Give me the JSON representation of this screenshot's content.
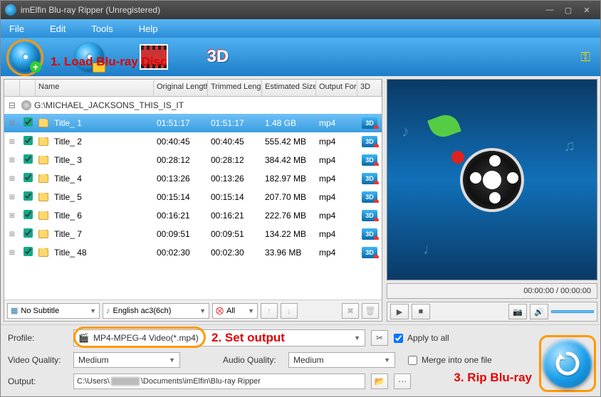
{
  "window": {
    "title": "imElfin Blu-ray Ripper (Unregistered)"
  },
  "menu": {
    "file": "File",
    "edit": "Edit",
    "tools": "Tools",
    "help": "Help"
  },
  "toolbar": {
    "load": "Load Blu-ray",
    "loadfolder": "Load Folder",
    "edit": "Edit",
    "threed": "3D"
  },
  "annotations": {
    "step1": "1. Load Blu-ray Disc",
    "step2": "2. Set output",
    "step3": "3. Rip Blu-ray"
  },
  "columns": {
    "name": "Name",
    "len": "Original Length",
    "trim": "Trimmed Length",
    "size": "Estimated Size",
    "fmt": "Output Format",
    "threeD": "3D"
  },
  "source": {
    "path": "G:\\MICHAEL_JACKSONS_THIS_IS_IT"
  },
  "rows": [
    {
      "name": "Title_ 1",
      "len": "01:51:17",
      "trim": "01:51:17",
      "size": "1.48 GB",
      "fmt": "mp4",
      "sel": true
    },
    {
      "name": "Title_ 2",
      "len": "00:40:45",
      "trim": "00:40:45",
      "size": "555.42 MB",
      "fmt": "mp4",
      "sel": false
    },
    {
      "name": "Title_ 3",
      "len": "00:28:12",
      "trim": "00:28:12",
      "size": "384.42 MB",
      "fmt": "mp4",
      "sel": false
    },
    {
      "name": "Title_ 4",
      "len": "00:13:26",
      "trim": "00:13:26",
      "size": "182.97 MB",
      "fmt": "mp4",
      "sel": false
    },
    {
      "name": "Title_ 5",
      "len": "00:15:14",
      "trim": "00:15:14",
      "size": "207.70 MB",
      "fmt": "mp4",
      "sel": false
    },
    {
      "name": "Title_ 6",
      "len": "00:16:21",
      "trim": "00:16:21",
      "size": "222.76 MB",
      "fmt": "mp4",
      "sel": false
    },
    {
      "name": "Title_ 7",
      "len": "00:09:51",
      "trim": "00:09:51",
      "size": "134.22 MB",
      "fmt": "mp4",
      "sel": false
    },
    {
      "name": "Title_ 48",
      "len": "00:02:30",
      "trim": "00:02:30",
      "size": "33.96 MB",
      "fmt": "mp4",
      "sel": false
    }
  ],
  "subs": {
    "value": "No Subtitle"
  },
  "audio": {
    "value": "English ac3(6ch)"
  },
  "all": {
    "value": "All"
  },
  "preview": {
    "time": "00:00:00 / 00:00:00"
  },
  "profile": {
    "label": "Profile:",
    "value": "MP4-MPEG-4 Video(*.mp4)"
  },
  "applyAll": {
    "label": "Apply to all",
    "checked": true
  },
  "videoQ": {
    "label": "Video Quality:",
    "value": "Medium"
  },
  "audioQ": {
    "label": "Audio Quality:",
    "value": "Medium"
  },
  "merge": {
    "label": "Merge into one file",
    "checked": false
  },
  "output": {
    "label": "Output:",
    "prefix": "C:\\Users\\",
    "suffix": "\\Documents\\imElfin\\Blu-ray Ripper"
  }
}
